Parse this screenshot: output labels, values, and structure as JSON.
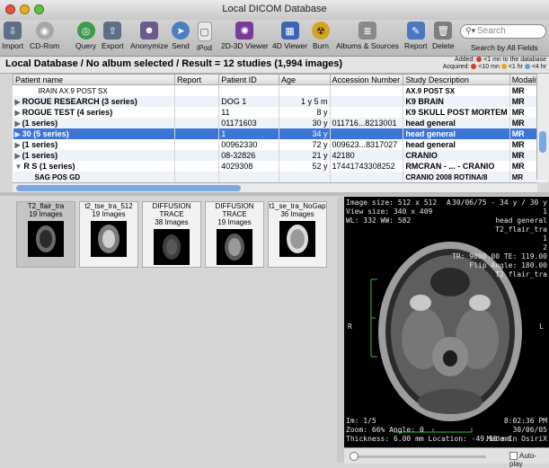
{
  "window": {
    "title": "Local DICOM Database"
  },
  "toolbar": {
    "items": [
      {
        "label": "Import",
        "icon": "import-icon",
        "color": "#5c6f86"
      },
      {
        "label": "CD-Rom",
        "icon": "cdrom-icon",
        "color": "#a8a8a8"
      },
      {
        "label": "Query",
        "icon": "query-icon",
        "color": "#3d9c4c"
      },
      {
        "label": "Export",
        "icon": "export-icon",
        "color": "#5c6f86"
      },
      {
        "label": "Anonymize",
        "icon": "anonymize-icon",
        "color": "#6b5b8c"
      },
      {
        "label": "Send",
        "icon": "send-icon",
        "color": "#4b7fc2"
      },
      {
        "label": "iPod",
        "icon": "ipod-icon",
        "color": "#e8e8e8"
      },
      {
        "label": "2D-3D Viewer",
        "icon": "viewer-2d3d-icon",
        "color": "#7a3c9a"
      },
      {
        "label": "4D Viewer",
        "icon": "viewer-4d-icon",
        "color": "#3b66b2"
      },
      {
        "label": "Burn",
        "icon": "burn-icon",
        "color": "#d6a51d"
      },
      {
        "label": "Albums & Sources",
        "icon": "albums-icon",
        "color": "#8a8a8a"
      },
      {
        "label": "Report",
        "icon": "report-icon",
        "color": "#4a78c0"
      },
      {
        "label": "Delete",
        "icon": "delete-icon",
        "color": "#7d7d7d"
      },
      {
        "label": "Search by All Fields",
        "icon": "search-fields-icon",
        "color": "#cccccc"
      }
    ],
    "search_placeholder": "Search"
  },
  "header": {
    "title": "Local Database / No album selected / Result = 12 studies (1,994 images)",
    "added_label": "Added:",
    "added_note": "<1 mn to the database",
    "acquired_label": "Acquired:",
    "acq_a": "<10 mn",
    "acq_b": "<1 hr",
    "acq_c": "<4 hr",
    "colors": {
      "red": "#d83b2a",
      "orange": "#f0a020",
      "blue": "#4da6e8"
    }
  },
  "table": {
    "columns": [
      "Patient name",
      "Report",
      "Patient ID",
      "Age",
      "Accession Number",
      "Study Description",
      "Modality"
    ],
    "rows": [
      {
        "name": "IRAIN AX.9 POST SX",
        "report": "",
        "id": "",
        "age": "",
        "acc": "",
        "desc": "AX.9 POST SX",
        "mod": "MR",
        "indent": true
      },
      {
        "name": "ROGUE RESEARCH (3 series)",
        "report": "",
        "id": "DOG 1",
        "age": "1 y 5 m",
        "acc": "",
        "desc": "K9 BRAIN",
        "mod": "MR"
      },
      {
        "name": "ROGUE TEST (4 series)",
        "report": "",
        "id": "11",
        "age": "8 y",
        "acc": "",
        "desc": "K9 SKULL POST MORTEM",
        "mod": "MR"
      },
      {
        "name": "(1 series)",
        "report": "",
        "id": "01171603",
        "age": "30 y",
        "acc": "011716...8213001",
        "desc": "head general",
        "mod": "MR"
      },
      {
        "name": "30 (5 series)",
        "report": "",
        "id": "1",
        "age": "34 y",
        "acc": "",
        "desc": "head general",
        "mod": "MR",
        "selected": true
      },
      {
        "name": "(1 series)",
        "report": "",
        "id": "00962330",
        "age": "72 y",
        "acc": "009623...8317027",
        "desc": "head general",
        "mod": "MR"
      },
      {
        "name": "(1 series)",
        "report": "",
        "id": "08-32826",
        "age": "21 y",
        "acc": "42180",
        "desc": "CRANIO",
        "mod": "MR"
      },
      {
        "name": "R S (1 series)",
        "report": "",
        "id": "4029308",
        "age": "52 y",
        "acc": "17441743308252",
        "desc": "RMCRAN - ... - CRANIO",
        "mod": "MR"
      },
      {
        "name": "SAG POS GD",
        "report": "",
        "id": "",
        "age": "",
        "acc": "",
        "desc": "CRANIO 2008 ROTINA/8",
        "mod": "MR",
        "indent": true
      }
    ]
  },
  "thumbnails": [
    {
      "title": "T2_flair_tra",
      "count": "19 Images",
      "selected": true
    },
    {
      "title": "t2_tse_tra_512",
      "count": "19 Images"
    },
    {
      "title": "DIFFUSION TRACE",
      "count": "38 Images"
    },
    {
      "title": "DIFFUSION TRACE",
      "count": "19 Images"
    },
    {
      "title": "t1_se_tra_NoGap",
      "count": "36 Images"
    }
  ],
  "viewer": {
    "tl1": "Image size: 512 x 512",
    "tl2": "View size: 340 x 409",
    "tl3": "WL: 332 WW: 582",
    "orient_top": "A",
    "tr1": "30/06/75 - 34 y / 30 y",
    "tr2": "1",
    "tr3": "head general",
    "tr4": "T2_flair_tra",
    "tr5": "1",
    "tr6": "2",
    "tr7": "TR: 9000.00 TE: 119.00",
    "tr8": "Flip Angle: 180.00",
    "tr9": "T2_flair_tra",
    "orient_left": "R",
    "orient_right": "L",
    "bl1": "Im: 1/5",
    "bl2": "Zoom: 66% Angle: 0",
    "bl3": "Thickness: 6.00 mm Location: -49.18 mm",
    "br1": "8:02:36 PM",
    "br2": "30/06/05",
    "br3": "Made In OsiriX"
  },
  "bottom": {
    "autoplay_label": "Auto-play"
  }
}
